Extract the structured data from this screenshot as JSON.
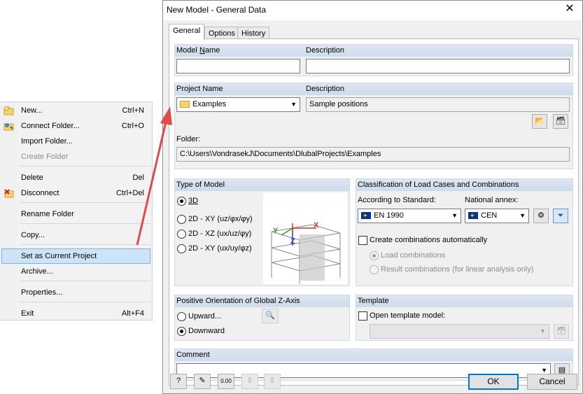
{
  "context_menu": {
    "items": [
      {
        "label": "New...",
        "shortcut": "Ctrl+N",
        "icon": "new-folder-icon"
      },
      {
        "label": "Connect Folder...",
        "shortcut": "Ctrl+O",
        "icon": "connect-folder-icon"
      },
      {
        "label": "Import Folder...",
        "shortcut": ""
      },
      {
        "label": "Create Folder",
        "shortcut": "",
        "disabled": true
      },
      {
        "label": "Delete",
        "shortcut": "Del"
      },
      {
        "label": "Disconnect",
        "shortcut": "Ctrl+Del",
        "icon": "disconnect-icon"
      },
      {
        "label": "Rename Folder",
        "shortcut": ""
      },
      {
        "label": "Copy...",
        "shortcut": ""
      },
      {
        "label": "Set as Current Project",
        "shortcut": "",
        "highlighted": true
      },
      {
        "label": "Archive...",
        "shortcut": ""
      },
      {
        "label": "Properties...",
        "shortcut": ""
      },
      {
        "label": "Exit",
        "shortcut": "Alt+F4"
      }
    ]
  },
  "dialog": {
    "title": "New Model - General Data",
    "close_icon": "close-icon",
    "tabs": [
      {
        "label": "General",
        "active": true
      },
      {
        "label": "Options"
      },
      {
        "label": "History"
      }
    ],
    "model_name": {
      "label_pre": "Model ",
      "label_u": "N",
      "label_post": "ame",
      "value": ""
    },
    "model_description": {
      "label": "Description",
      "value": ""
    },
    "project_name": {
      "label": "Project Name",
      "value": "Examples"
    },
    "project_description": {
      "label": "Description",
      "value": "Sample positions"
    },
    "folder": {
      "label": "Folder:",
      "value": "C:\\Users\\VondrasekJ\\Documents\\DlubalProjects\\Examples"
    },
    "type_of_model": {
      "title": "Type of Model",
      "options": [
        {
          "label": "3D",
          "selected": true
        },
        {
          "label": "2D - XY (uz/φx/φy)"
        },
        {
          "label": "2D - XZ (ux/uz/φy)"
        },
        {
          "label": "2D - XY (ux/uy/φz)"
        }
      ],
      "axis_x": "X",
      "axis_y": "Y",
      "axis_z": "Z"
    },
    "classification": {
      "title": "Classification of Load Cases and Combinations",
      "standard_label": "According to Standard:",
      "standard_value": "EN 1990",
      "annex_label": "National annex:",
      "annex_value": "CEN",
      "create_combinations_label": "Create combinations automatically",
      "create_combinations_checked": false,
      "load_combinations_label": "Load combinations",
      "result_combinations_label": "Result combinations (for linear analysis only)"
    },
    "orientation": {
      "title": "Positive Orientation of Global Z-Axis",
      "options": [
        {
          "label": "Upward..."
        },
        {
          "label": "Downward",
          "selected": true
        }
      ]
    },
    "template": {
      "title": "Template",
      "open_label": "Open template model:",
      "checked": false
    },
    "comment": {
      "label": "Comment",
      "value": ""
    },
    "ok_label": "OK",
    "cancel_label": "Cancel",
    "accent_color": "#0078d7",
    "arrow_color": "#e04a48"
  }
}
